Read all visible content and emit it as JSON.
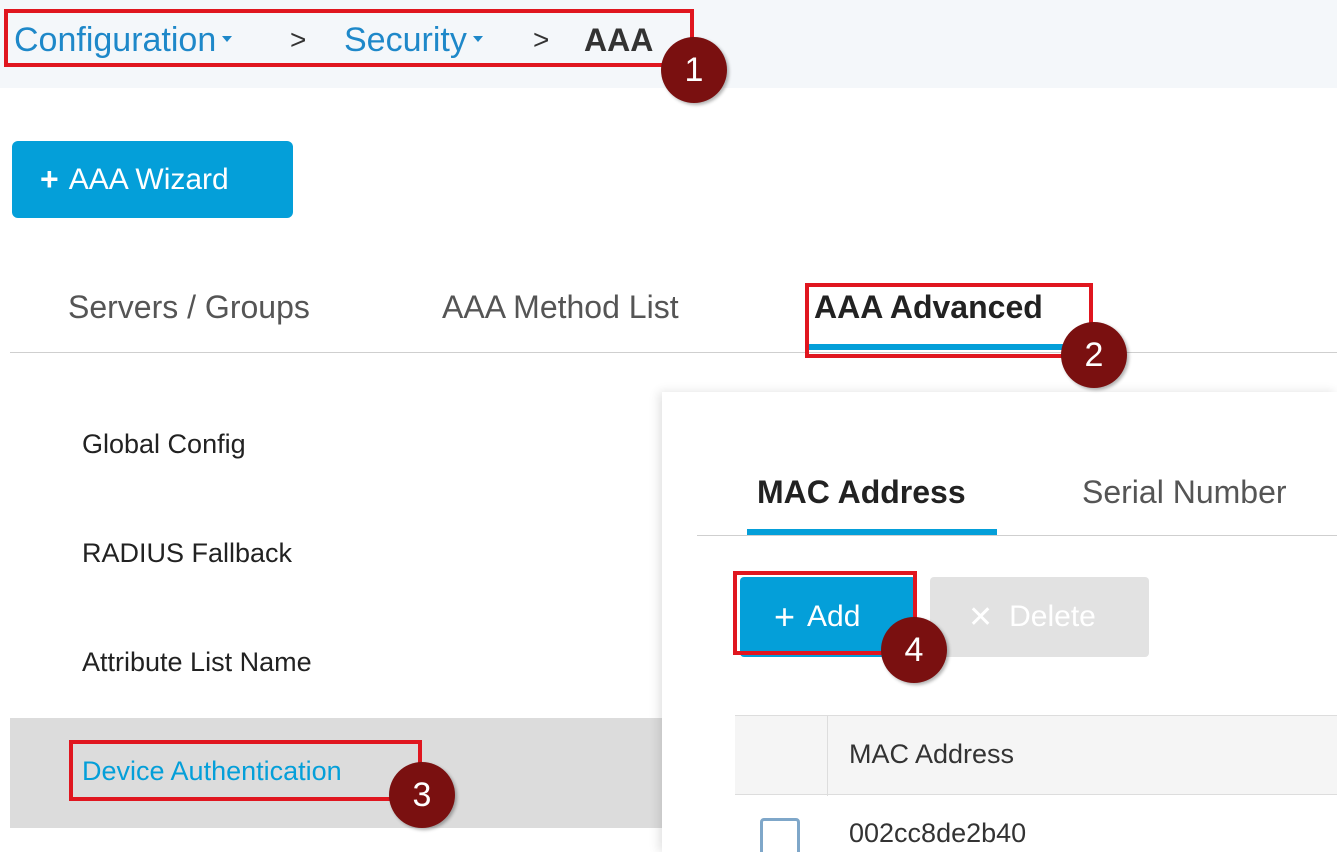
{
  "breadcrumb": {
    "items": [
      {
        "label": "Configuration",
        "has_dropdown": true
      },
      {
        "label": "Security",
        "has_dropdown": true
      }
    ],
    "separator": ">",
    "current": "AAA"
  },
  "wizard_button": {
    "icon": "plus-icon",
    "label": "AAA Wizard"
  },
  "top_tabs": [
    {
      "label": "Servers / Groups",
      "active": false
    },
    {
      "label": "AAA Method List",
      "active": false
    },
    {
      "label": "AAA Advanced",
      "active": true
    }
  ],
  "side_menu": [
    {
      "label": "Global Config",
      "active": false
    },
    {
      "label": "RADIUS Fallback",
      "active": false
    },
    {
      "label": "Attribute List Name",
      "active": false
    },
    {
      "label": "Device Authentication",
      "active": true
    }
  ],
  "sub_tabs": [
    {
      "label": "MAC Address",
      "active": true
    },
    {
      "label": "Serial Number",
      "active": false
    }
  ],
  "toolbar": {
    "add": {
      "icon": "plus-icon",
      "label": "Add"
    },
    "delete": {
      "icon": "close-icon",
      "label": "Delete",
      "disabled": true
    }
  },
  "table": {
    "columns": [
      "MAC Address"
    ],
    "rows": [
      {
        "mac": "002cc8de2b40",
        "checked": false
      }
    ]
  },
  "annotations": [
    {
      "number": "1",
      "target": "breadcrumb"
    },
    {
      "number": "2",
      "target": "AAA Advanced"
    },
    {
      "number": "3",
      "target": "Device Authentication"
    },
    {
      "number": "4",
      "target": "Add"
    }
  ],
  "colors": {
    "accent": "#049fd9",
    "highlight_box": "#e0161f",
    "badge": "#7a1010",
    "selected_row": "#dcdcdc"
  }
}
